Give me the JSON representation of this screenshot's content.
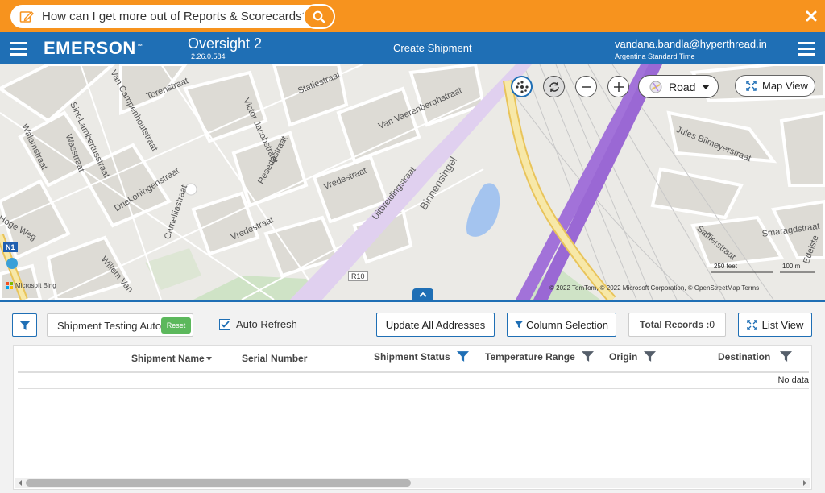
{
  "search": {
    "question": "How can I get more out of Reports & Scorecards?"
  },
  "header": {
    "brand": "EMERSON",
    "trademark": "™",
    "app_name": "Oversight 2",
    "version": "2.26.0.584",
    "page_title": "Create Shipment",
    "user_email": "vandana.bandla@hyperthread.in",
    "timezone": "Argentina Standard Time"
  },
  "map": {
    "road_label": "Road",
    "map_view_label": "Map View",
    "scale_feet": "250 feet",
    "scale_meters": "100 m",
    "attribution": "© 2022 TomTom, © 2022 Microsoft Corporation, © OpenStreetMap  Terms",
    "bing": "Microsoft Bing",
    "street_labels": {
      "a": "Van Campenhoutstraat",
      "b": "Torenstraat",
      "c": "Sint-Lambertusstraat",
      "d": "Walemstraat",
      "e": "Wasstraat",
      "f": "Victor Jacobstraat",
      "g": "Statiestraat",
      "h": "Van Vaerenberghstraat",
      "i": "Driekoningenstraat",
      "j": "Resedastraat",
      "k": "Vredestraat",
      "l": "Vredestraat",
      "m": "Uitbreidingstraat",
      "n": "Binnensingel",
      "o": "Camelliastraat",
      "p": "Hoge Weg",
      "q": "Willem Van",
      "r": "Jules Bilmeyerstraat",
      "s": "Saffierstraat",
      "t": "Smaragdstraat",
      "u": "Edelste",
      "v": "R10",
      "w": "N1"
    }
  },
  "toolbar": {
    "saved_filter": "Shipment Testing Auto",
    "reset": "Reset",
    "auto_refresh": "Auto Refresh",
    "update_all": "Update All Addresses",
    "column_selection": "Column Selection",
    "total_records_label": "Total Records : ",
    "total_records_value": "0",
    "list_view": "List View"
  },
  "grid": {
    "columns": [
      "Shipment Name",
      "Serial Number",
      "Shipment Status",
      "Temperature Range",
      "Origin",
      "Destination"
    ],
    "no_data": "No data"
  },
  "colors": {
    "orange": "#f7931e",
    "blue": "#1f6fb5",
    "green": "#5cb85c"
  }
}
